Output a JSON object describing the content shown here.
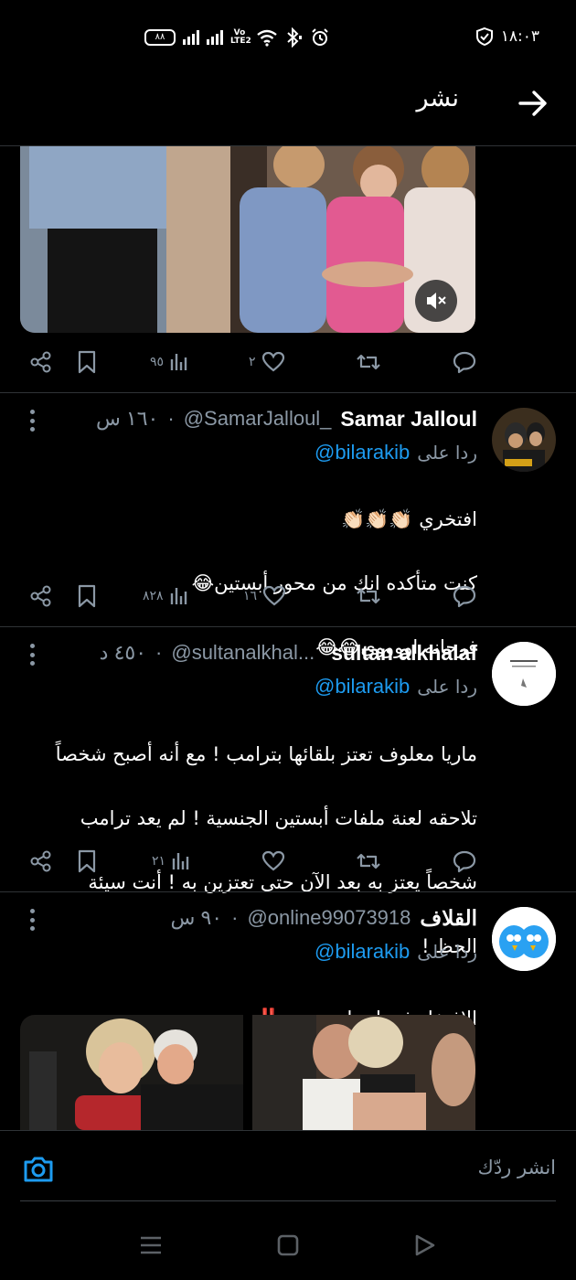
{
  "status_bar": {
    "time": "١٨:٠٣",
    "battery": "٨٨",
    "volte": "Vo LTE2"
  },
  "header": {
    "title": "نشر"
  },
  "top_tweet_actions": {
    "views": "٩٥",
    "likes": "٢",
    "retweets": "",
    "replies": ""
  },
  "tweets": [
    {
      "name": "Samar Jalloul",
      "handle": "@SamarJalloul_",
      "time": "١٦٠ س",
      "reply_label": "ردا على",
      "reply_to": "@bilarakib",
      "text_lines": [
        "افتخري 👏🏻👏🏻👏🏻",
        "كنت متأكده انك من محور أبستين😂",
        "فرحانه اووووي😂😂"
      ],
      "views": "٨٢٨",
      "likes": "١٦",
      "retweets": "",
      "replies": ""
    },
    {
      "name": "sultan alkhalaf",
      "handle": "@sultanalkhal...",
      "time": "٤٥٠ د",
      "reply_label": "ردا على",
      "reply_to": "@bilarakib",
      "text_lines": [
        "ماريا معلوف تعتز بلقائها بترامب  ! مع أنه أصبح شخصاً",
        "تلاحقه لعنة ملفات أبستين الجنسية ! لم يعد ترامب",
        "شخصاً يعتز به بعد الآن حتى تعتزين به ! أنت سيئة",
        "الحظ !"
      ],
      "views": "٢١",
      "likes": "",
      "retweets": "",
      "replies": ""
    },
    {
      "name": "القلاف",
      "handle": "@online99073918",
      "time": "٩٠ س",
      "reply_label": "ردا على",
      "reply_to": "@bilarakib",
      "text_lines": [
        "الافتخار في اجمل صورة ‼️"
      ]
    }
  ],
  "reply_bar": {
    "placeholder": "انشر ردّك"
  },
  "colors": {
    "background": "#000000",
    "accent": "#1d9bf0",
    "muted": "#8b98a5",
    "divider": "#2f3336"
  },
  "icons": [
    "back-arrow-icon",
    "share-icon",
    "bookmark-icon",
    "views-icon",
    "heart-icon",
    "retweet-icon",
    "reply-icon",
    "camera-icon",
    "mute-icon",
    "more-icon"
  ]
}
